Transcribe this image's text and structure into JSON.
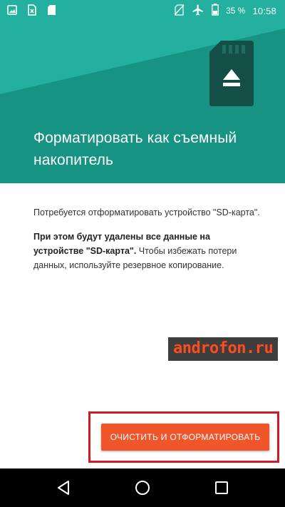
{
  "status_bar": {
    "battery_percent": "35 %",
    "time": "10:58",
    "left_icons": [
      "image-notification-icon",
      "sim-notification-icon",
      "sd-card-notification-icon"
    ],
    "right_icons": [
      "no-sim-icon",
      "airplane-mode-icon",
      "battery-icon"
    ]
  },
  "header": {
    "title": "Форматировать как съемный накопитель",
    "background_color": "#199d8d",
    "icon": "sd-card-eject-icon"
  },
  "content": {
    "paragraph1": "Потребуется отформатировать устройство \"SD-карта\".",
    "paragraph2_bold": "При этом будут удалены все данные на устройстве \"SD-карта\".",
    "paragraph2_rest": " Чтобы избежать потери данных, используйте резервное копирование."
  },
  "watermark": {
    "text": "androfon.ru"
  },
  "action": {
    "button_label": "ОЧИСТИТЬ И ОТФОРМАТИРОВАТЬ",
    "button_color": "#f0562a",
    "highlight_color": "#d11a24"
  },
  "nav_bar": {
    "buttons": [
      "back-icon",
      "home-icon",
      "recents-icon"
    ]
  }
}
